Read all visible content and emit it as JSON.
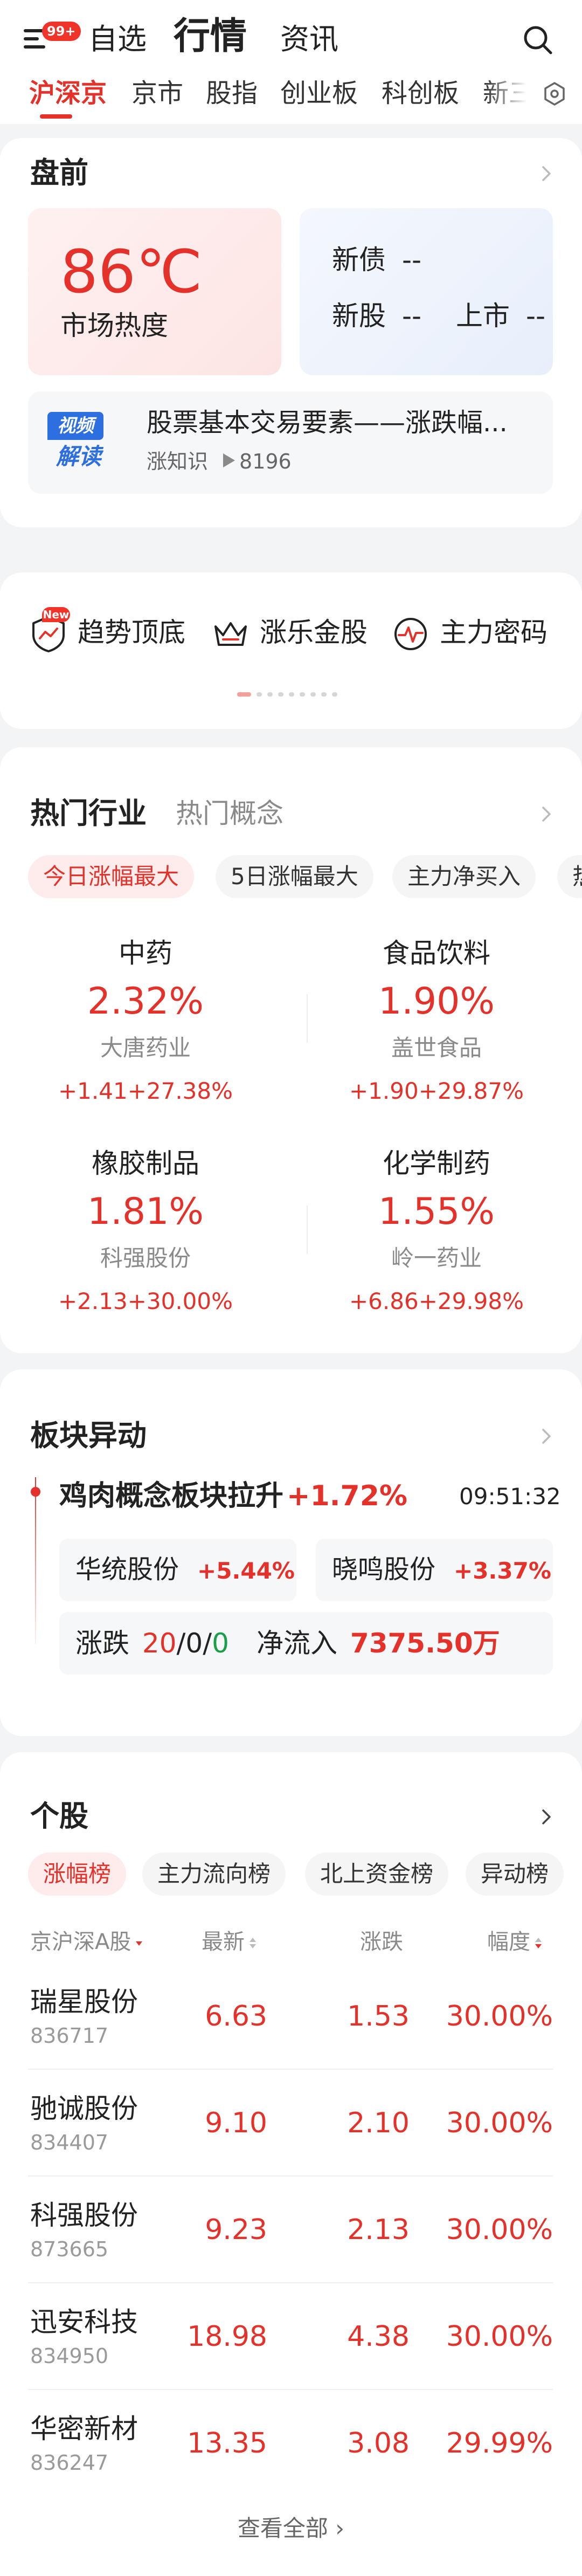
{
  "header": {
    "badge": "99+",
    "tabs": [
      "自选",
      "行情",
      "资讯"
    ],
    "active_tab": "行情"
  },
  "subtabs": [
    "沪深京",
    "京市",
    "股指",
    "创业板",
    "科创板",
    "新三"
  ],
  "premarket": {
    "title": "盘前",
    "heat_value": "86℃",
    "heat_label": "市场热度",
    "new_bond_label": "新债",
    "new_bond_value": "--",
    "new_stock_label": "新股",
    "new_stock_value": "--",
    "listing_label": "上市",
    "listing_value": "--",
    "video": {
      "badge_top": "视频",
      "badge_bottom": "解读",
      "title": "股票基本交易要素——涨跌幅...",
      "source": "涨知识",
      "plays": "8196"
    }
  },
  "shortcuts": [
    {
      "label": "趋势顶底",
      "tag": "New"
    },
    {
      "label": "涨乐金股"
    },
    {
      "label": "主力密码"
    }
  ],
  "hot": {
    "title_active": "热门行业",
    "title_inactive": "热门概念",
    "pills": [
      "今日涨幅最大",
      "5日涨幅最大",
      "主力净买入",
      "热"
    ],
    "industries": [
      {
        "name": "中药",
        "pct": "2.32%",
        "leader": "大唐药业",
        "chg": "+1.41",
        "chg_pct": "+27.38%"
      },
      {
        "name": "食品饮料",
        "pct": "1.90%",
        "leader": "盖世食品",
        "chg": "+1.90",
        "chg_pct": "+29.87%"
      },
      {
        "name": "橡胶制品",
        "pct": "1.81%",
        "leader": "科强股份",
        "chg": "+2.13",
        "chg_pct": "+30.00%"
      },
      {
        "name": "化学制药",
        "pct": "1.55%",
        "leader": "岭一药业",
        "chg": "+6.86",
        "chg_pct": "+29.98%"
      }
    ]
  },
  "abnormal": {
    "title": "板块异动",
    "headline": "鸡肉概念板块拉升",
    "headline_pct": "+1.72%",
    "time": "09:51:32",
    "stocks": [
      {
        "name": "华统股份",
        "pct": "+5.44%"
      },
      {
        "name": "晓鸣股份",
        "pct": "+3.37%"
      }
    ],
    "updown_label": "涨跌",
    "up": "20",
    "sep": "/",
    "flat": "0",
    "down": "0",
    "inflow_label": "净流入",
    "inflow_value": "7375.50万"
  },
  "stocks": {
    "title": "个股",
    "tabs": [
      "涨幅榜",
      "主力流向榜",
      "北上资金榜",
      "异动榜"
    ],
    "columns": [
      "京沪深A股",
      "最新",
      "涨跌",
      "幅度"
    ],
    "rows": [
      {
        "name": "瑞星股份",
        "code": "836717",
        "price": "6.63",
        "chg": "1.53",
        "pct": "30.00%"
      },
      {
        "name": "驰诚股份",
        "code": "834407",
        "price": "9.10",
        "chg": "2.10",
        "pct": "30.00%"
      },
      {
        "name": "科强股份",
        "code": "873665",
        "price": "9.23",
        "chg": "2.13",
        "pct": "30.00%"
      },
      {
        "name": "迅安科技",
        "code": "834950",
        "price": "18.98",
        "chg": "4.38",
        "pct": "30.00%"
      },
      {
        "name": "华密新材",
        "code": "836247",
        "price": "13.35",
        "chg": "3.08",
        "pct": "29.99%"
      }
    ],
    "view_all": "查看全部 ›"
  },
  "colors": {
    "accent": "#e4322b",
    "link": "#2d6fe0",
    "bg": "#f3f4f6"
  }
}
